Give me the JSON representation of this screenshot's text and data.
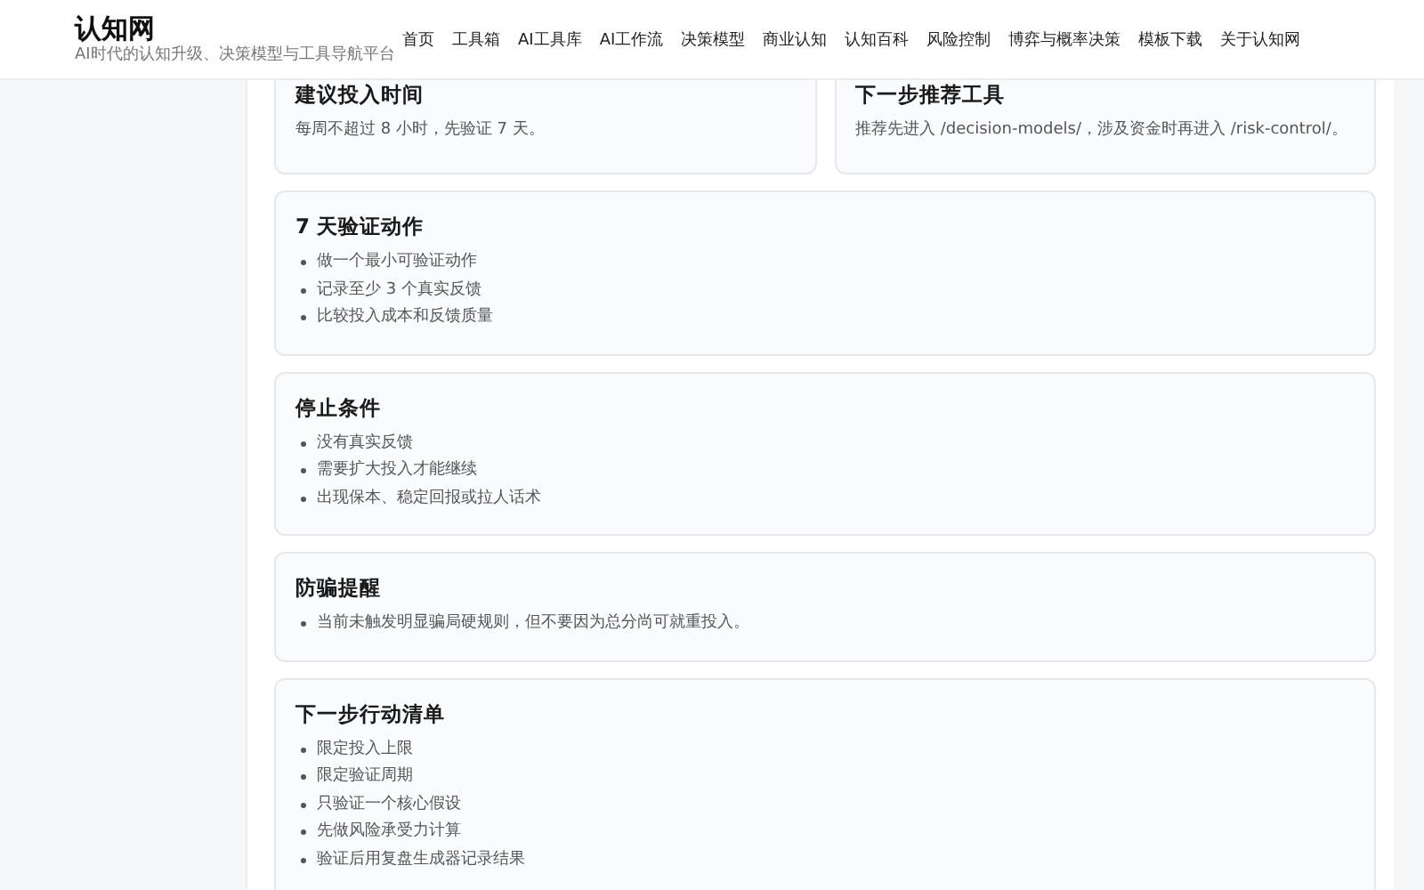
{
  "site": {
    "title": "认知网",
    "tagline": "AI时代的认知升级、决策模型与工具导航平台"
  },
  "nav": [
    {
      "label": "首页"
    },
    {
      "label": "工具箱"
    },
    {
      "label": "AI工具库"
    },
    {
      "label": "AI工作流"
    },
    {
      "label": "决策模型"
    },
    {
      "label": "商业认知"
    },
    {
      "label": "认知百科"
    },
    {
      "label": "风险控制"
    },
    {
      "label": "博弈与概率决策"
    },
    {
      "label": "模板下载"
    },
    {
      "label": "关于认知网"
    }
  ],
  "summary_cards": [
    {
      "title": "建议投入时间",
      "text": "每周不超过 8 小时，先验证 7 天。"
    },
    {
      "title": "下一步推荐工具",
      "text": "推荐先进入 /decision-models/，涉及资金时再进入 /risk-control/。"
    }
  ],
  "sections": [
    {
      "title": "7 天验证动作",
      "items": [
        "做一个最小可验证动作",
        "记录至少 3 个真实反馈",
        "比较投入成本和反馈质量"
      ]
    },
    {
      "title": "停止条件",
      "items": [
        "没有真实反馈",
        "需要扩大投入才能继续",
        "出现保本、稳定回报或拉人话术"
      ]
    },
    {
      "title": "防骗提醒",
      "items": [
        "当前未触发明显骗局硬规则，但不要因为总分尚可就重投入。"
      ]
    },
    {
      "title": "下一步行动清单",
      "items": [
        "限定投入上限",
        "限定验证周期",
        "只验证一个核心假设",
        "先做风险承受力计算",
        "验证后用复盘生成器记录结果"
      ]
    }
  ]
}
